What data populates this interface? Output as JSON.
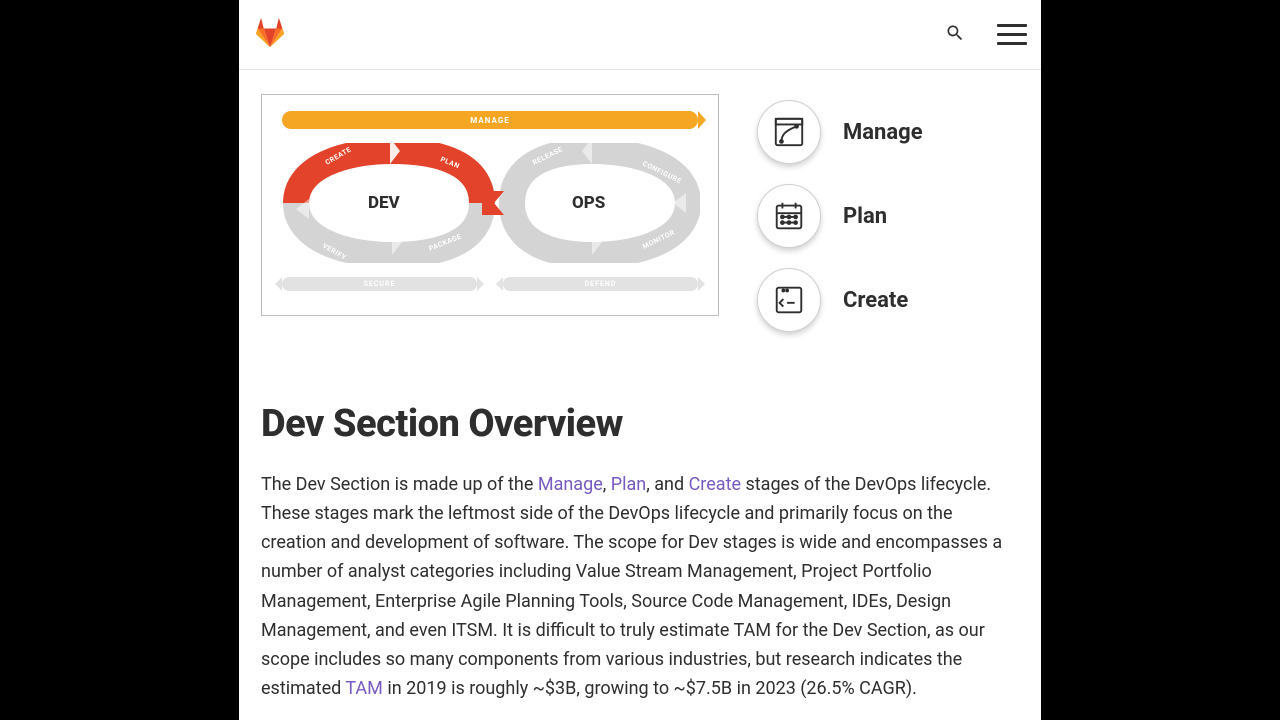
{
  "diagram": {
    "manage_label": "MANAGE",
    "dev_label": "DEV",
    "ops_label": "OPS",
    "secure_label": "SECURE",
    "defend_label": "DEFEND",
    "segments": {
      "create": "CREATE",
      "plan": "PLAN",
      "verify": "VERIFY",
      "package": "PACKAGE",
      "release": "RELEASE",
      "configure": "CONFIGURE",
      "monitor": "MONITOR"
    }
  },
  "stages": [
    {
      "label": "Manage"
    },
    {
      "label": "Plan"
    },
    {
      "label": "Create"
    }
  ],
  "heading": "Dev Section Overview",
  "para": {
    "t1": "The Dev Section is made up of the ",
    "link1": "Manage",
    "t2": ", ",
    "link2": "Plan",
    "t3": ", and ",
    "link3": "Create",
    "t4": " stages of the DevOps lifecycle. These stages mark the leftmost side of the DevOps lifecycle and primarily focus on the creation and development of software. The scope for Dev stages is wide and encompasses a number of analyst categories including Value Stream Management, Project Portfolio Management, Enterprise Agile Planning Tools, Source Code Management, IDEs, Design Management, and even ITSM. It is difficult to truly estimate TAM for the Dev Section, as our scope includes so many components from various industries, but research indicates the estimated ",
    "link4": "TAM",
    "t5": " in 2019 is roughly ~$3B, growing to ~$7.5B in 2023 (26.5% CAGR)."
  }
}
